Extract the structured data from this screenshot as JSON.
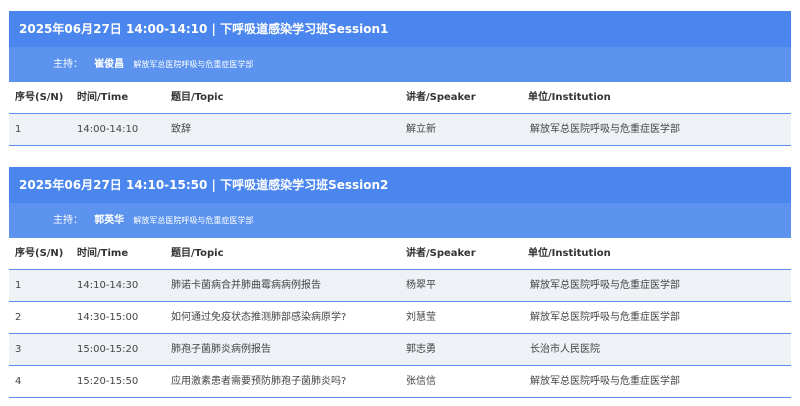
{
  "headers": {
    "no": "序号(S/N)",
    "time": "时间/Time",
    "topic": "题目/Topic",
    "speaker": "讲者/Speaker",
    "institution": "单位/Institution"
  },
  "sessions": [
    {
      "title": "2025年06月27日 14:00-14:10 | 下呼吸道感染学习班Session1",
      "host_label": "主持：",
      "host_name": "崔俊昌",
      "host_org": "解放军总医院呼吸与危重症医学部",
      "rows": [
        {
          "no": "1",
          "time": "14:00-14:10",
          "topic": "致辞",
          "speaker": "解立新",
          "institution": "解放军总医院呼吸与危重症医学部"
        }
      ]
    },
    {
      "title": "2025年06月27日 14:10-15:50 | 下呼吸道感染学习班Session2",
      "host_label": "主持：",
      "host_name": "郭英华",
      "host_org": "解放军总医院呼吸与危重症医学部",
      "rows": [
        {
          "no": "1",
          "time": "14:10-14:30",
          "topic": "肺诺卡菌病合并肺曲霉病病例报告",
          "speaker": "杨翠平",
          "institution": "解放军总医院呼吸与危重症医学部"
        },
        {
          "no": "2",
          "time": "14:30-15:00",
          "topic": "如何通过免疫状态推测肺部感染病原学?",
          "speaker": "刘慧莹",
          "institution": "解放军总医院呼吸与危重症医学部"
        },
        {
          "no": "3",
          "time": "15:00-15:20",
          "topic": "肺孢子菌肺炎病例报告",
          "speaker": "郭志勇",
          "institution": "长治市人民医院"
        },
        {
          "no": "4",
          "time": "15:20-15:50",
          "topic": "应用激素患者需要预防肺孢子菌肺炎吗?",
          "speaker": "张信信",
          "institution": "解放军总医院呼吸与危重症医学部"
        }
      ]
    }
  ],
  "colors": {
    "header_blue": "#4b86ee",
    "host_blue": "#5b93ef",
    "row_alt": "#eef1f5",
    "divider": "#5b8fe6"
  }
}
